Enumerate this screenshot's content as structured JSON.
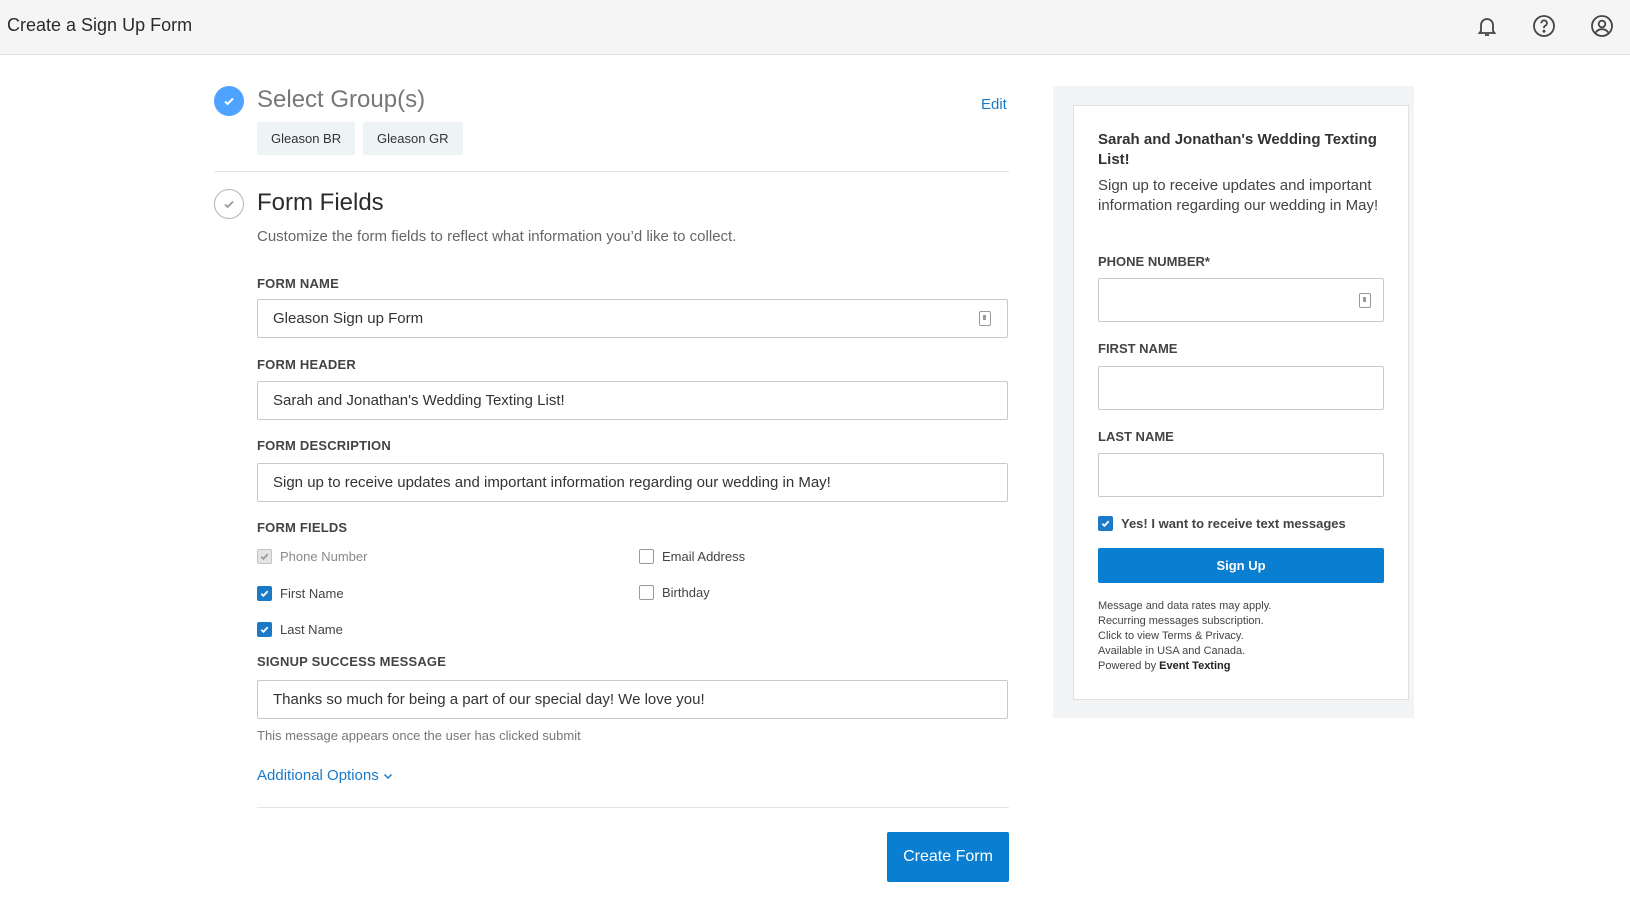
{
  "header": {
    "title": "Create a Sign Up Form",
    "icons": [
      "bell-icon",
      "help-icon",
      "account-icon"
    ]
  },
  "groups_step": {
    "title": "Select Group(s)",
    "edit_label": "Edit",
    "chips": [
      "Gleason BR",
      "Gleason GR"
    ]
  },
  "fields_step": {
    "title": "Form Fields",
    "subtitle": "Customize the form fields to reflect what information you’d like to collect.",
    "form_name": {
      "label": "FORM NAME",
      "value": "Gleason Sign up Form"
    },
    "form_header": {
      "label": "FORM HEADER",
      "value": "Sarah and Jonathan's Wedding Texting List!"
    },
    "form_description": {
      "label": "FORM DESCRIPTION",
      "value": "Sign up to receive updates and important information regarding our wedding in May!"
    },
    "form_fields": {
      "label": "FORM FIELDS",
      "options": [
        {
          "label": "Phone Number",
          "checked": true,
          "disabled": true
        },
        {
          "label": "Email Address",
          "checked": false,
          "disabled": false
        },
        {
          "label": "First Name",
          "checked": true,
          "disabled": false
        },
        {
          "label": "Birthday",
          "checked": false,
          "disabled": false
        },
        {
          "label": "Last Name",
          "checked": true,
          "disabled": false
        }
      ]
    },
    "success_message": {
      "label": "SIGNUP SUCCESS MESSAGE",
      "value": "Thanks so much for being a part of our special day! We love you!",
      "hint": "This message appears once the user has clicked submit"
    },
    "additional_options_label": "Additional Options",
    "create_button_label": "Create Form"
  },
  "preview": {
    "header": "Sarah and Jonathan's Wedding Texting List!",
    "description": "Sign up to receive updates and important information regarding our wedding in May!",
    "phone_label": "PHONE NUMBER*",
    "first_name_label": "FIRST NAME",
    "last_name_label": "LAST NAME",
    "consent_label": "Yes! I want to receive text messages",
    "signup_button_label": "Sign Up",
    "footer": {
      "line1": "Message and data rates may apply.",
      "line2": "Recurring messages subscription.",
      "line3": "Click to view Terms & Privacy.",
      "line4": "Available in USA and Canada.",
      "line5_prefix": "Powered by",
      "line5_brand": "Event Texting"
    }
  },
  "colors": {
    "accent": "#0a7fd2",
    "link": "#1a7ac8",
    "step_done": "#4da3ff"
  }
}
